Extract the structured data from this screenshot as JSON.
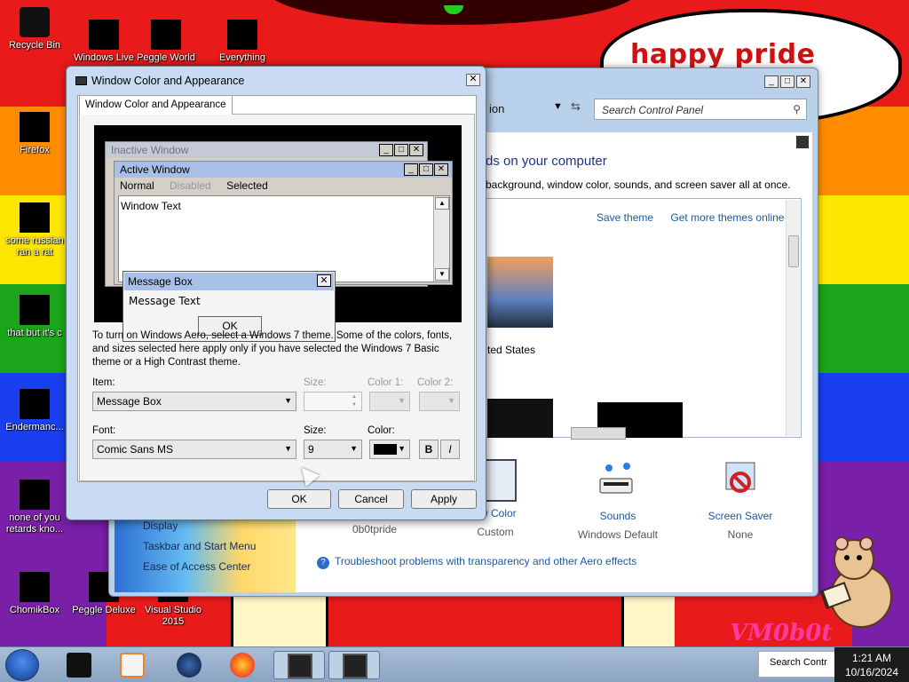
{
  "desktop": {
    "bubble_text": "happy pride month",
    "watermark": "VM0b0t",
    "icons": [
      {
        "label": "Recycle Bin"
      },
      {
        "label": "Windows Live"
      },
      {
        "label": "Peggle World"
      },
      {
        "label": "Everything"
      },
      {
        "label": "Firefox"
      },
      {
        "label": "some russian ran a rat"
      },
      {
        "label": "that but it's c"
      },
      {
        "label": "Endermanc..."
      },
      {
        "label": "none of you retards kno..."
      },
      {
        "label": "ChomikBox"
      },
      {
        "label": "Peggle Deluxe"
      },
      {
        "label": "Visual Studio 2015"
      }
    ]
  },
  "control_panel": {
    "breadcrumb": "ion",
    "search_placeholder": "Search Control Panel",
    "heading": "ds on your computer",
    "description": "background, window color, sounds, and screen saver all at once.",
    "links": {
      "save_theme": "Save theme",
      "get_more": "Get more themes online"
    },
    "theme_label": "ted States",
    "bottom_items": [
      {
        "title": "ow Color",
        "subtitle": "Custom"
      },
      {
        "title": "Sounds",
        "subtitle": "Windows Default"
      },
      {
        "title": "Screen Saver",
        "subtitle": "None"
      }
    ],
    "current_theme_name": "0b0tpride",
    "left_pane": [
      "Display",
      "Taskbar and Start Menu",
      "Ease of Access Center"
    ],
    "troubleshoot": "Troubleshoot problems with transparency and other Aero effects"
  },
  "dialog": {
    "title": "Window Color and Appearance",
    "tab": "Window Color and Appearance",
    "preview": {
      "inactive_title": "Inactive Window",
      "active_title": "Active Window",
      "menu_normal": "Normal",
      "menu_disabled": "Disabled",
      "menu_selected": "Selected",
      "window_text": "Window Text",
      "msgbox_title": "Message Box",
      "msgbox_text": "Message Text",
      "msgbox_ok": "OK"
    },
    "info_text": "To turn on Windows Aero, select a Windows 7 theme.  Some of the colors, fonts, and sizes selected here apply only if you have selected the Windows 7 Basic theme or a High Contrast theme.",
    "item_label": "Item:",
    "item_value": "Message Box",
    "size_label": "Size:",
    "color1_label": "Color 1:",
    "color2_label": "Color 2:",
    "font_label": "Font:",
    "font_value": "Comic Sans MS",
    "font_size_label": "Size:",
    "font_size_value": "9",
    "color_label": "Color:",
    "font_color": "#000000",
    "bold_label": "B",
    "italic_label": "I",
    "buttons": {
      "ok": "OK",
      "cancel": "Cancel",
      "apply": "Apply"
    }
  },
  "taskbar": {
    "tray_text": "Search Contr",
    "time": "1:21 AM",
    "date": "10/16/2024"
  }
}
